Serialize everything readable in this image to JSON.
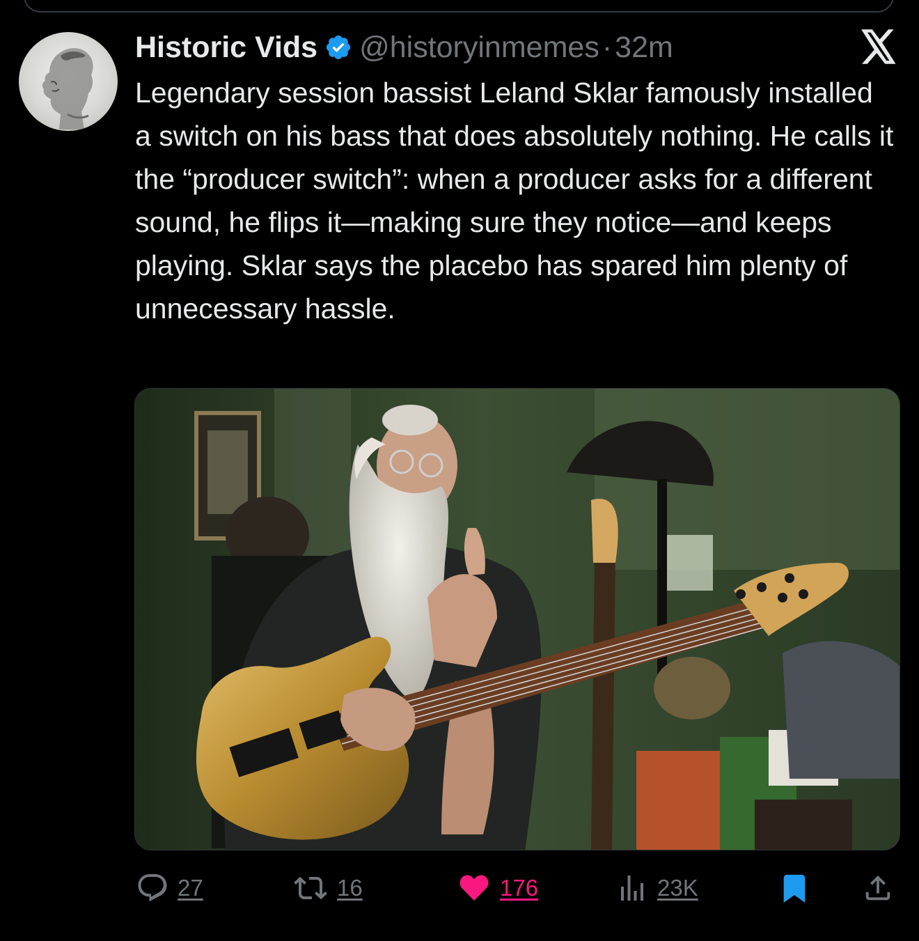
{
  "tweet": {
    "author_name": "Historic Vids",
    "handle": "@historyinmemes",
    "separator": "·",
    "time": "32m",
    "text": "Legendary session bassist Leland Sklar famously installed a switch on his bass that does absolutely nothing. He calls it the “producer switch”: when a producer asks for a different sound, he flips it—making sure they notice—and keeps playing. Sklar says the placebo has spared him plenty of unnecessary hassle.",
    "verified": true,
    "avatar_icon": "profile-avatar",
    "platform_icon": "x-logo-icon"
  },
  "actions": {
    "replies": "27",
    "reposts": "16",
    "likes": "176",
    "views": "23K",
    "liked": true,
    "bookmarked": true
  },
  "colors": {
    "background": "#000000",
    "text": "#e7e9ea",
    "muted": "#71767b",
    "verified": "#1d9bf0",
    "like": "#f91880",
    "bookmark": "#1d9bf0"
  }
}
